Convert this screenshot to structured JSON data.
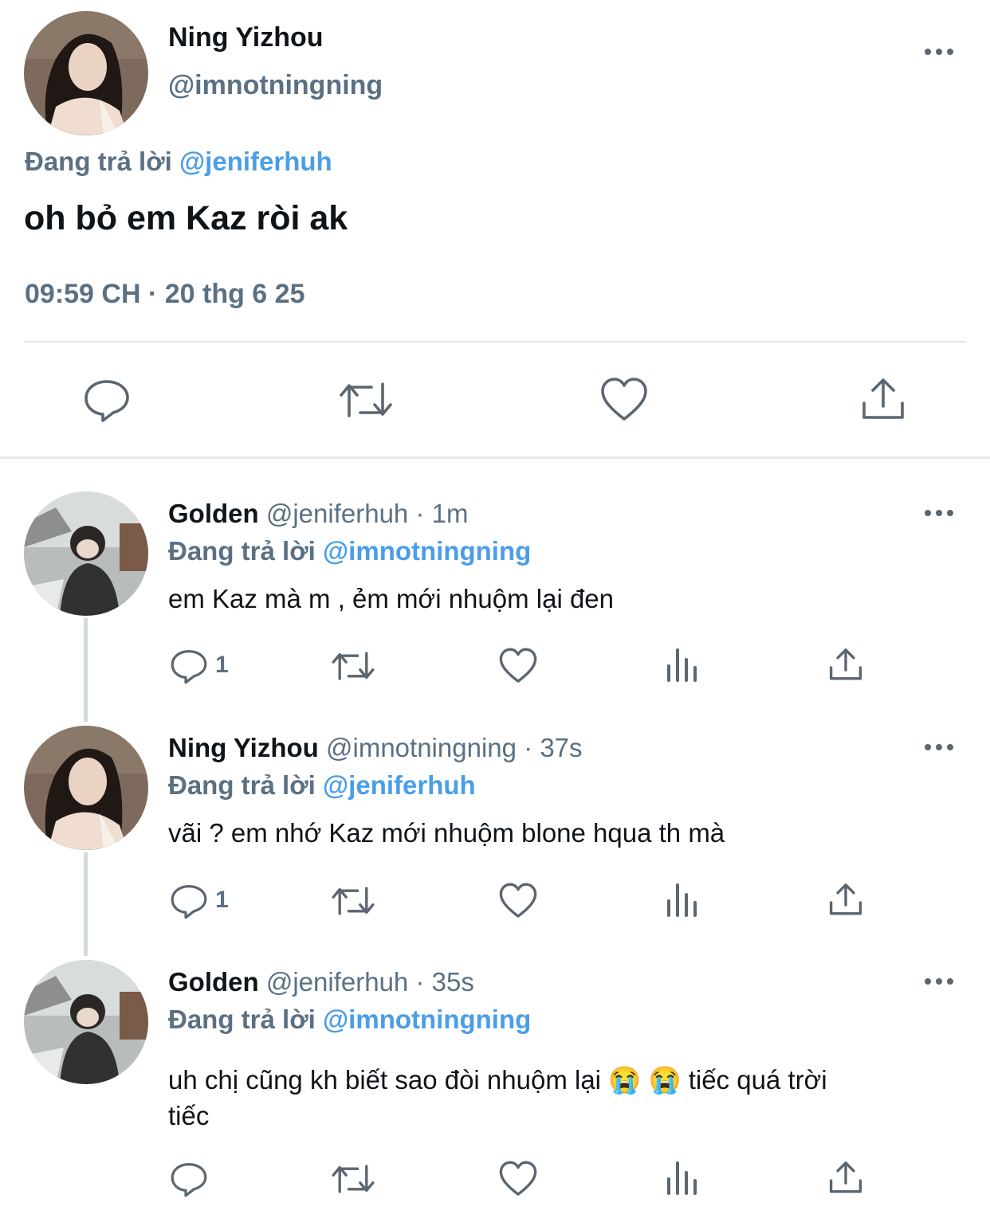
{
  "main_tweet": {
    "name": "Ning Yizhou",
    "handle": "@imnotningning",
    "reply_prefix": "Đang trả lời",
    "reply_to": "@jeniferhuh",
    "text": "oh bỏ em Kaz ròi ak",
    "timestamp": "09:59 CH · 20 thg 6 25"
  },
  "replies": [
    {
      "name": "Golden",
      "handle": "@jeniferhuh",
      "time": "· 1m",
      "reply_prefix": "Đang trả lời",
      "reply_to": "@imnotningning",
      "text": "em Kaz mà m , ẻm mới nhuộm lại đen",
      "reply_count": "1"
    },
    {
      "name": "Ning Yizhou",
      "handle": "@imnotningning",
      "time": "· 37s",
      "reply_prefix": "Đang trả lời",
      "reply_to": "@jeniferhuh",
      "text": "vãi ? em nhớ Kaz mới nhuộm blone hqua th mà",
      "reply_count": "1"
    },
    {
      "name": "Golden",
      "handle": "@jeniferhuh",
      "time": "· 35s",
      "reply_prefix": "Đang trả lời",
      "reply_to": "@imnotningning",
      "text_line1": "uh chị cũng kh biết sao đòi nhuộm lại 😭 😭  tiếc quá trời",
      "text_line2": "tiếc",
      "reply_count": ""
    }
  ],
  "colors": {
    "text": "#0f1419",
    "secondary": "#5b7083",
    "link": "#4a9ee8",
    "divider": "#e6e9ec"
  },
  "icons": [
    "reply-icon",
    "retweet-icon",
    "like-icon",
    "share-icon",
    "analytics-icon",
    "more-icon"
  ]
}
